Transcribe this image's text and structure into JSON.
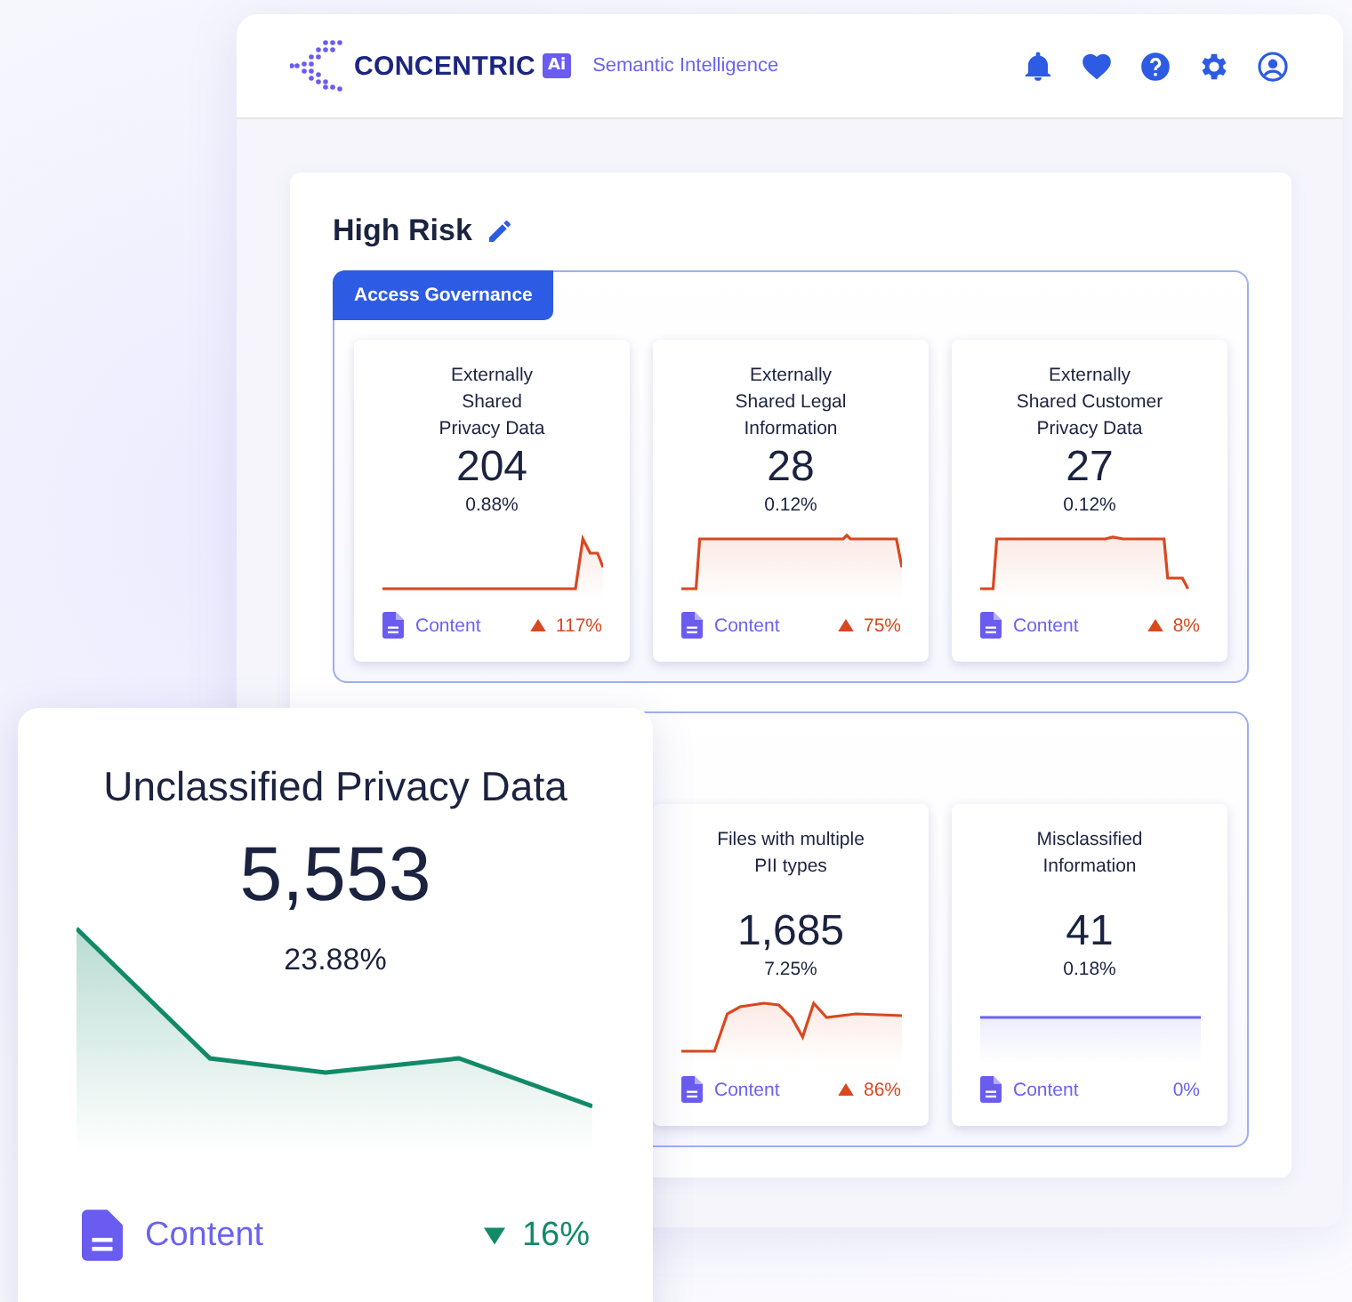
{
  "header": {
    "logo_text": "CONCENTRIC",
    "logo_badge": "Ai",
    "tagline": "Semantic Intelligence"
  },
  "panel": {
    "title": "High Risk",
    "groups": [
      {
        "label": "Access Governance",
        "cards": [
          {
            "title": "Externally\nShared\nPrivacy Data",
            "value": "204",
            "percent": "0.88%",
            "sparkline": {
              "kind": "spike"
            },
            "source": "Content",
            "trend": {
              "kind": "up",
              "color": "#d9481f"
            },
            "change": "117%"
          },
          {
            "title": "Externally\nShared Legal\nInformation",
            "value": "28",
            "percent": "0.12%",
            "sparkline": {
              "kind": "plateau"
            },
            "source": "Content",
            "trend": {
              "kind": "up",
              "color": "#d9481f"
            },
            "change": "75%"
          },
          {
            "title": "Externally\nShared Customer\nPrivacy Data",
            "value": "27",
            "percent": "0.12%",
            "sparkline": {
              "kind": "plateau-drop"
            },
            "source": "Content",
            "trend": {
              "kind": "up",
              "color": "#d9481f"
            },
            "change": "8%"
          }
        ]
      },
      {
        "cards": [
          {
            "title": "Files with multiple\nPII types",
            "value": "1,685",
            "percent": "7.25%",
            "sparkline": {
              "kind": "jagged"
            },
            "source": "Content",
            "trend": {
              "kind": "up",
              "color": "#d9481f"
            },
            "change": "86%"
          },
          {
            "title": "Misclassified\nInformation",
            "value": "41",
            "percent": "0.18%",
            "sparkline": {
              "kind": "flat"
            },
            "source": "Content",
            "trend": {
              "kind": "none",
              "color": "#6a63f0"
            },
            "change": "0%"
          }
        ]
      }
    ]
  },
  "featured_card": {
    "title": "Unclassified Privacy Data",
    "value": "5,553",
    "percent": "23.88%",
    "sparkline": {
      "kind": "decline"
    },
    "source": "Content",
    "trend": {
      "kind": "down",
      "color": "#128a68"
    },
    "change": "16%"
  }
}
